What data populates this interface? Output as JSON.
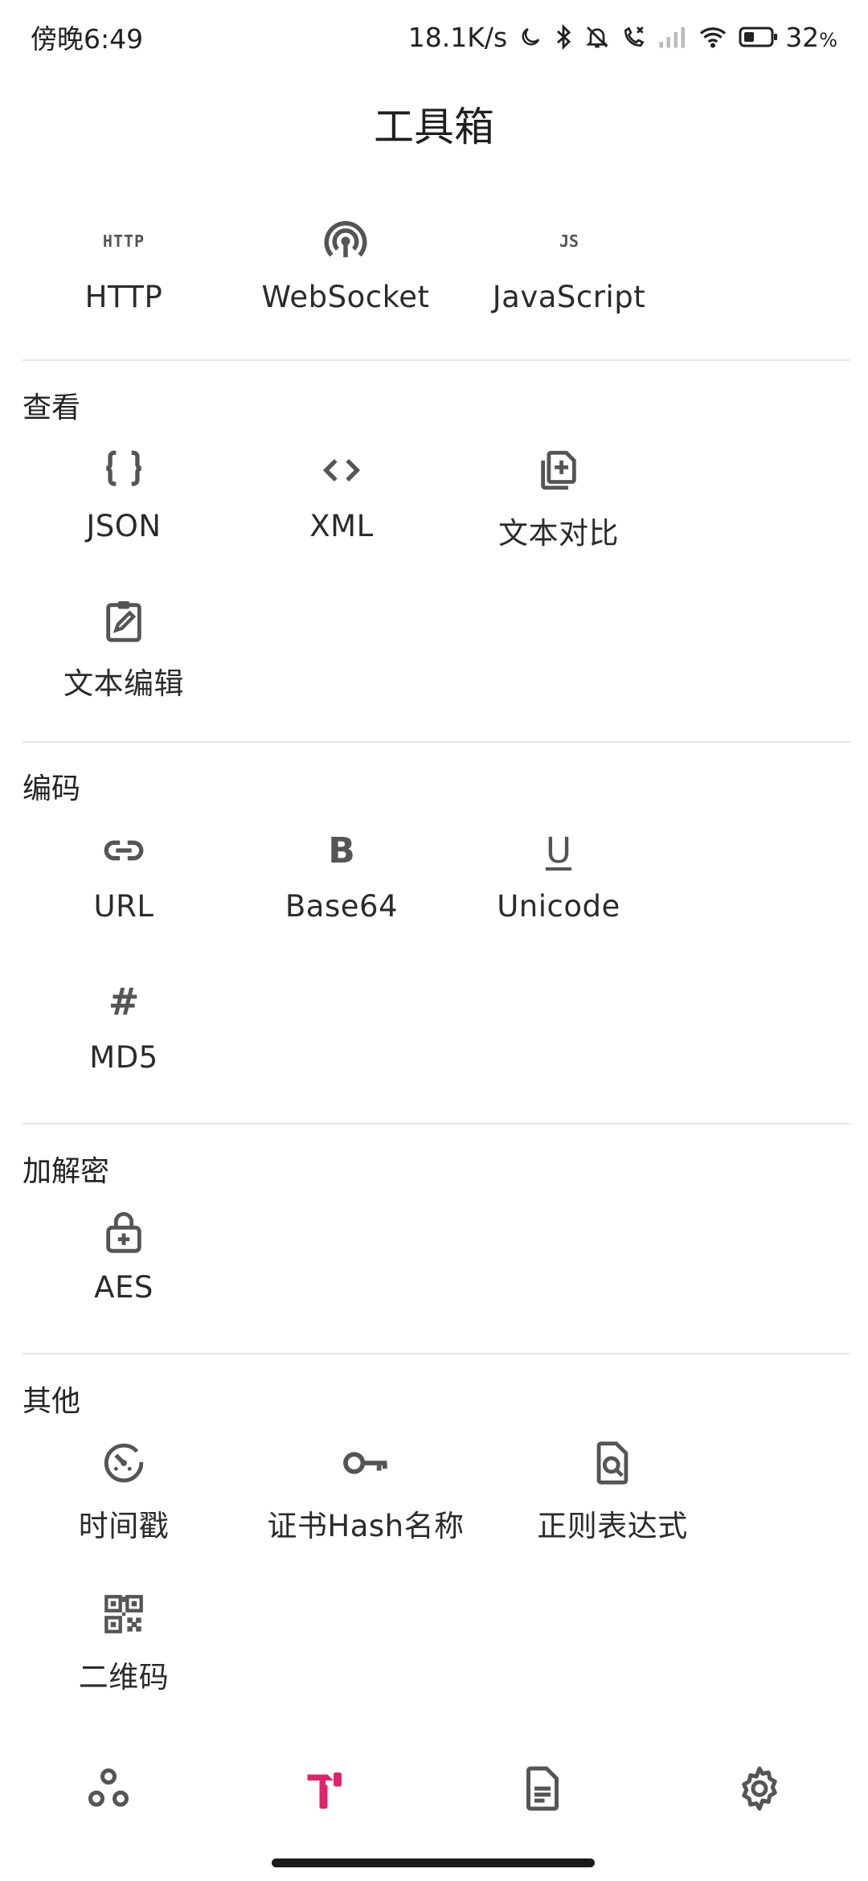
{
  "status_bar": {
    "time": "傍晚6:49",
    "net_speed": "18.1K/s",
    "battery": "32",
    "battery_unit": "%"
  },
  "title": "工具箱",
  "top_tools": [
    {
      "label": "HTTP",
      "icon": "http-text-icon",
      "icon_text": "HTTP"
    },
    {
      "label": "WebSocket",
      "icon": "broadcast-icon"
    },
    {
      "label": "JavaScript",
      "icon": "js-text-icon",
      "icon_text": "JS"
    }
  ],
  "sections": [
    {
      "title": "查看",
      "tools": [
        {
          "label": "JSON",
          "icon": "braces-icon"
        },
        {
          "label": "XML",
          "icon": "code-brackets-icon"
        },
        {
          "label": "文本对比",
          "icon": "library-add-icon"
        },
        {
          "label": "文本编辑",
          "icon": "clipboard-edit-icon"
        }
      ]
    },
    {
      "title": "编码",
      "tools": [
        {
          "label": "URL",
          "icon": "link-icon"
        },
        {
          "label": "Base64",
          "icon": "bold-b-icon",
          "icon_text": "B"
        },
        {
          "label": "Unicode",
          "icon": "underline-u-icon",
          "icon_text": "U"
        },
        {
          "label": "MD5",
          "icon": "hash-icon",
          "icon_text": "#"
        }
      ]
    },
    {
      "title": "加解密",
      "tools": [
        {
          "label": "AES",
          "icon": "lock-plus-icon"
        }
      ]
    },
    {
      "title": "其他",
      "tools": [
        {
          "label": "时间戳",
          "icon": "timer-icon"
        },
        {
          "label": "证书Hash名称",
          "icon": "key-icon"
        },
        {
          "label": "正则表达式",
          "icon": "file-search-icon"
        },
        {
          "label": "二维码",
          "icon": "qr-code-icon"
        }
      ]
    }
  ],
  "bottom_nav": [
    {
      "name": "network",
      "icon": "bubbles-icon",
      "active": false
    },
    {
      "name": "toolbox",
      "icon": "hammer-icon",
      "active": true
    },
    {
      "name": "logs",
      "icon": "document-icon",
      "active": false
    },
    {
      "name": "settings",
      "icon": "gear-icon",
      "active": false
    }
  ],
  "colors": {
    "accent": "#e0246c",
    "icon": "#555555",
    "text": "#2b2b2b",
    "divider": "#e6e6e6"
  }
}
